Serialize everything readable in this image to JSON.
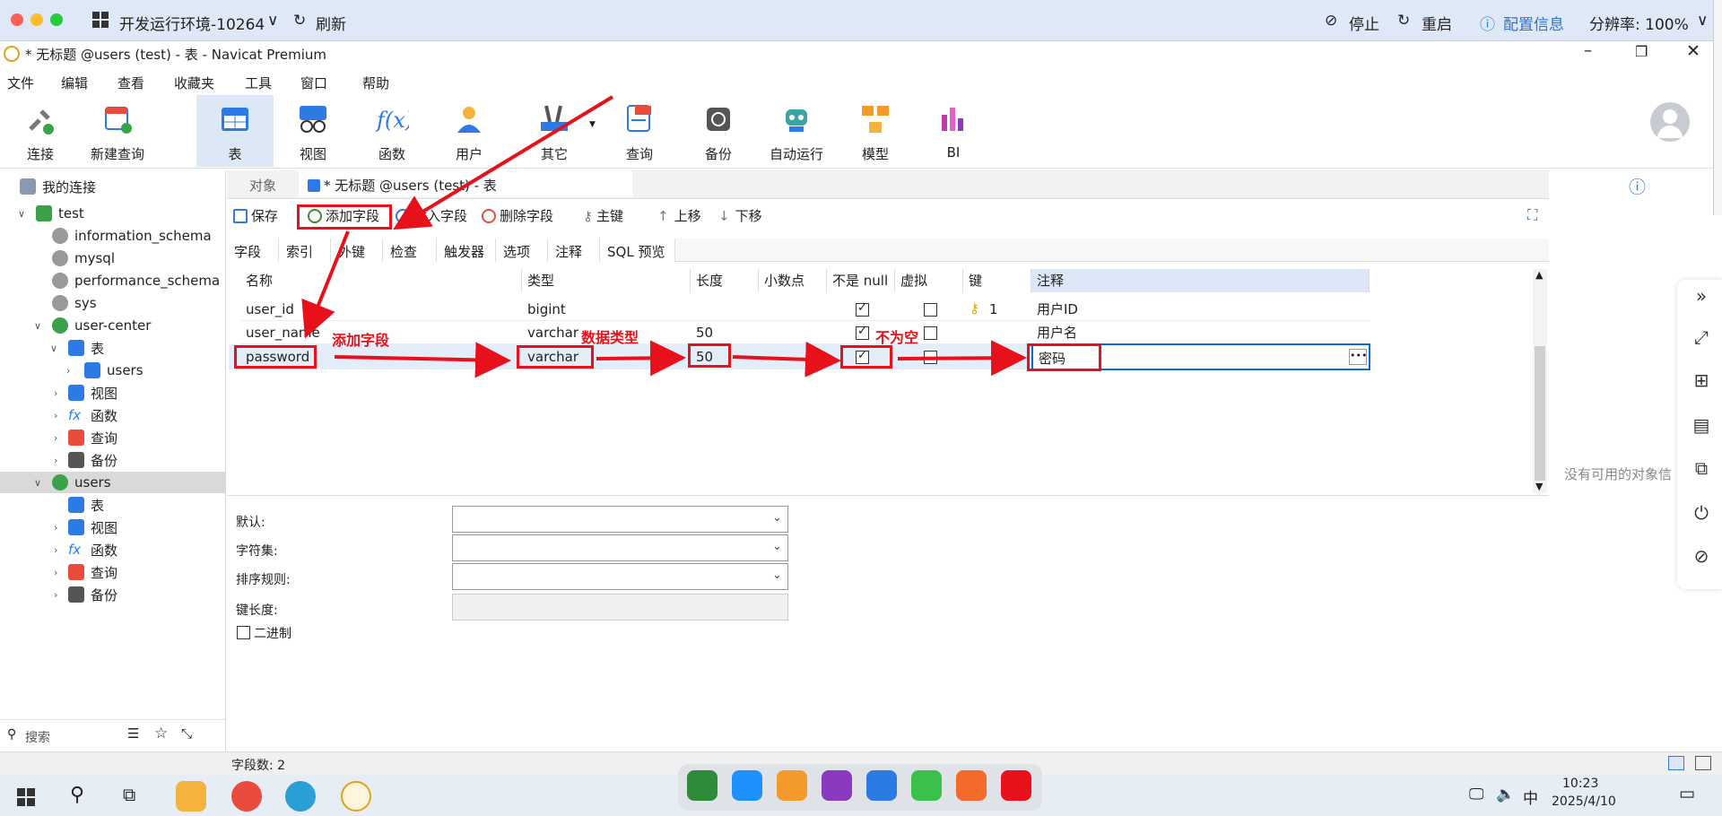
{
  "vm_bar": {
    "env_title": "开发运行环境-10264",
    "refresh": "刷新",
    "stop": "停止",
    "restart": "重启",
    "config": "配置信息",
    "resolution": "分辨率: 100%"
  },
  "window": {
    "title": "* 无标题 @users (test) - 表 - Navicat Premium"
  },
  "menu": [
    "文件",
    "编辑",
    "查看",
    "收藏夹",
    "工具",
    "窗口",
    "帮助"
  ],
  "toolbar": [
    "连接",
    "新建查询",
    "表",
    "视图",
    "函数",
    "用户",
    "其它",
    "查询",
    "备份",
    "自动运行",
    "模型",
    "BI"
  ],
  "sidebar": {
    "header": "我的连接",
    "tree": [
      {
        "label": "test"
      },
      {
        "label": "information_schema"
      },
      {
        "label": "mysql"
      },
      {
        "label": "performance_schema"
      },
      {
        "label": "sys"
      },
      {
        "label": "user-center"
      },
      {
        "label": "表"
      },
      {
        "label": "users"
      },
      {
        "label": "视图"
      },
      {
        "label": "函数"
      },
      {
        "label": "查询"
      },
      {
        "label": "备份"
      },
      {
        "label": "users"
      },
      {
        "label": "表"
      },
      {
        "label": "视图"
      },
      {
        "label": "函数"
      },
      {
        "label": "查询"
      },
      {
        "label": "备份"
      }
    ],
    "search_placeholder": "搜索"
  },
  "tabs": {
    "objects": "对象",
    "active": "* 无标题 @users (test) - 表"
  },
  "editor_toolbar": {
    "save": "保存",
    "add_field": "添加字段",
    "insert_field": "插入字段",
    "delete_field": "删除字段",
    "primary_key": "主键",
    "move_up": "上移",
    "move_down": "下移"
  },
  "sub_tabs": [
    "字段",
    "索引",
    "外键",
    "检查",
    "触发器",
    "选项",
    "注释",
    "SQL 预览"
  ],
  "columns": [
    "名称",
    "类型",
    "长度",
    "小数点",
    "不是 null",
    "虚拟",
    "键",
    "注释"
  ],
  "rows": [
    {
      "name": "user_id",
      "type": "bigint",
      "length": "",
      "not_null": true,
      "virtual": false,
      "key": "1",
      "comment": "用户ID"
    },
    {
      "name": "user_name",
      "type": "varchar",
      "length": "50",
      "not_null": true,
      "virtual": false,
      "key": "",
      "comment": "用户名"
    },
    {
      "name": "password",
      "type": "varchar",
      "length": "50",
      "not_null": true,
      "virtual": false,
      "key": "",
      "comment": "密码"
    }
  ],
  "properties": {
    "default": "默认:",
    "charset": "字符集:",
    "collation": "排序规则:",
    "key_length": "键长度:",
    "binary": "二进制"
  },
  "annotations": {
    "add_field": "添加字段",
    "data_type": "数据类型",
    "not_null": "不为空"
  },
  "right_panel": {
    "empty": "没有可用的对象信"
  },
  "status": {
    "field_count": "字段数: 2"
  },
  "taskbar": {
    "time": "10:23",
    "date": "2025/4/10",
    "ime": "中"
  },
  "colors": {
    "annotation_red": "#e8101b",
    "selection_blue": "#0b6bd4",
    "vm_bar": "#dfe8f7"
  }
}
